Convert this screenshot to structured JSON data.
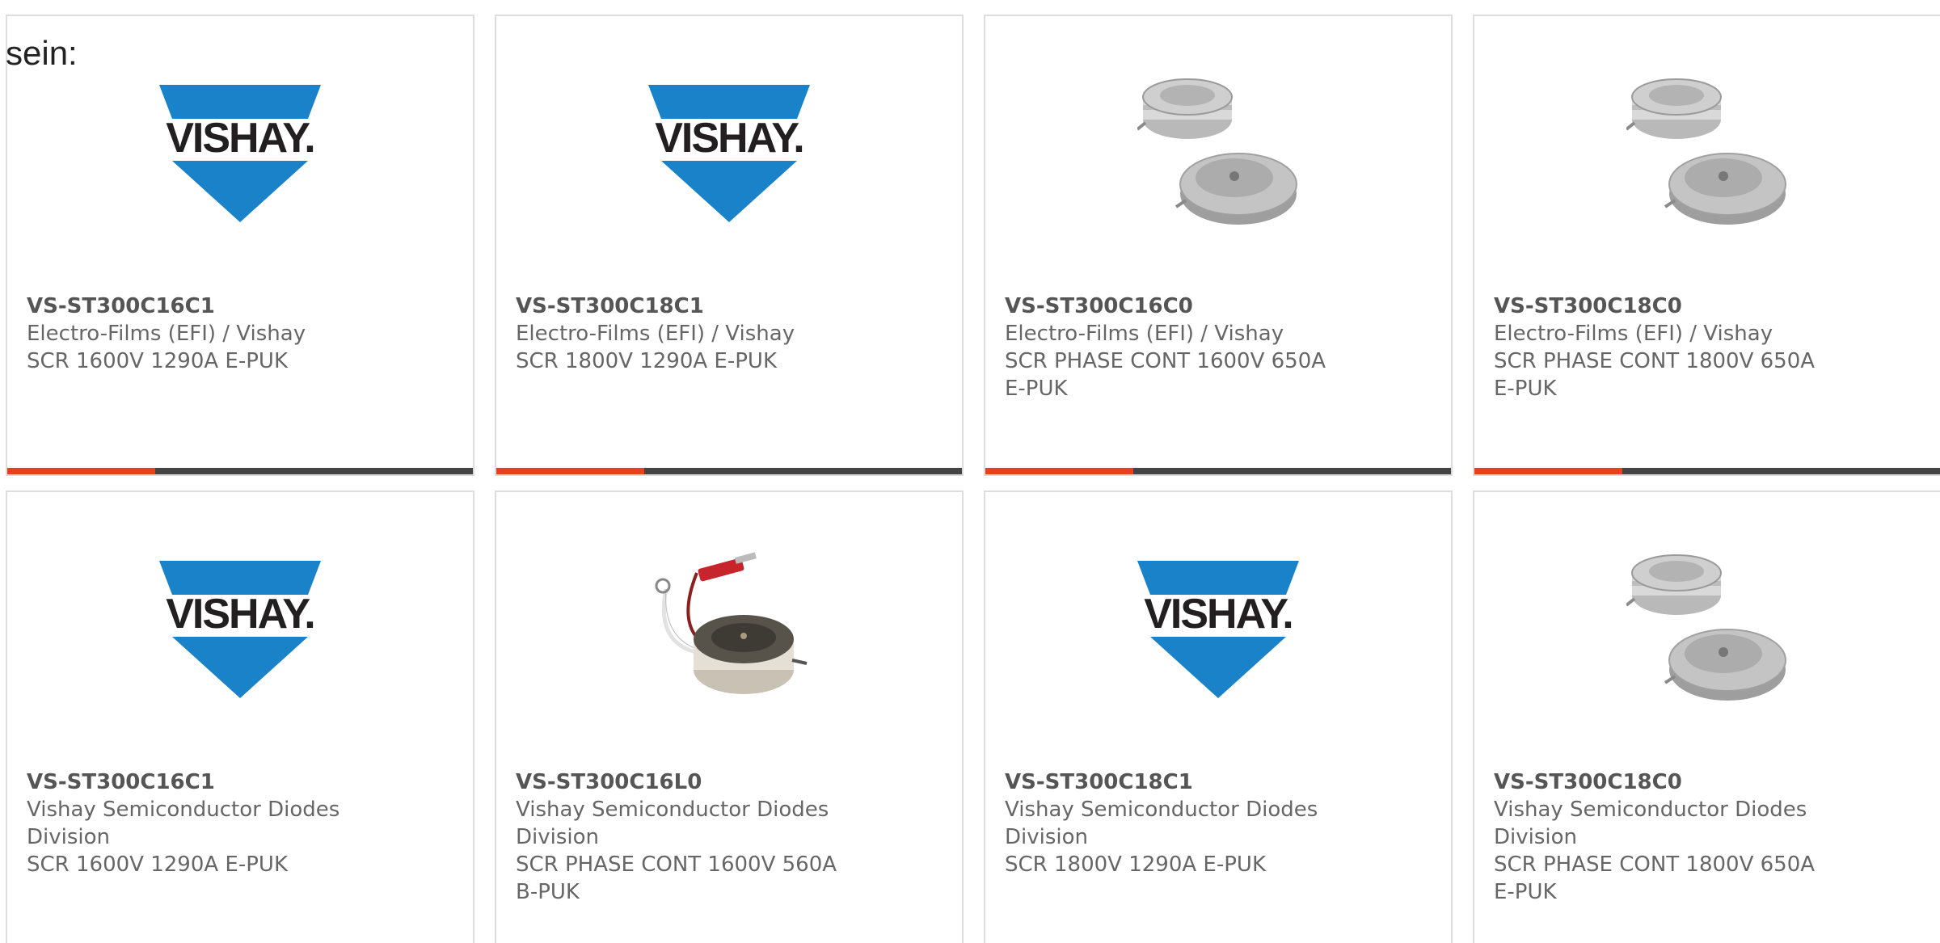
{
  "intro_text": "sein:",
  "colors": {
    "accent": "#e8411e",
    "bar_dark": "#444444",
    "vishay_blue": "#1a82c8"
  },
  "cards": [
    {
      "part_number": "VS-ST300C16C1",
      "manufacturer": "Electro-Films (EFI) / Vishay",
      "description": "SCR 1600V 1290A E-PUK",
      "image": "vishay-logo",
      "has_bar": true
    },
    {
      "part_number": "VS-ST300C18C1",
      "manufacturer": "Electro-Films (EFI) / Vishay",
      "description": "SCR 1800V 1290A E-PUK",
      "image": "vishay-logo",
      "has_bar": true
    },
    {
      "part_number": "VS-ST300C16C0",
      "manufacturer": "Electro-Films (EFI) / Vishay",
      "description": "SCR PHASE CONT 1600V 650A E-PUK",
      "image": "puk-thyristor-pair",
      "has_bar": true
    },
    {
      "part_number": "VS-ST300C18C0",
      "manufacturer": "Electro-Films (EFI) / Vishay",
      "description": "SCR PHASE CONT 1800V 650A E-PUK",
      "image": "puk-thyristor-pair",
      "has_bar": true
    },
    {
      "part_number": "VS-ST300C16C1",
      "manufacturer": "Vishay Semiconductor Diodes Division",
      "description": "SCR 1600V 1290A E-PUK",
      "image": "vishay-logo",
      "has_bar": false
    },
    {
      "part_number": "VS-ST300C16L0",
      "manufacturer": "Vishay Semiconductor Diodes Division",
      "description": "SCR PHASE CONT 1600V 560A B-PUK",
      "image": "puk-thyristor-leads",
      "has_bar": false
    },
    {
      "part_number": "VS-ST300C18C1",
      "manufacturer": "Vishay Semiconductor Diodes Division",
      "description": "SCR 1800V 1290A E-PUK",
      "image": "vishay-logo",
      "has_bar": false
    },
    {
      "part_number": "VS-ST300C18C0",
      "manufacturer": "Vishay Semiconductor Diodes Division",
      "description": "SCR PHASE CONT 1800V 650A E-PUK",
      "image": "puk-thyristor-pair",
      "has_bar": false
    }
  ]
}
